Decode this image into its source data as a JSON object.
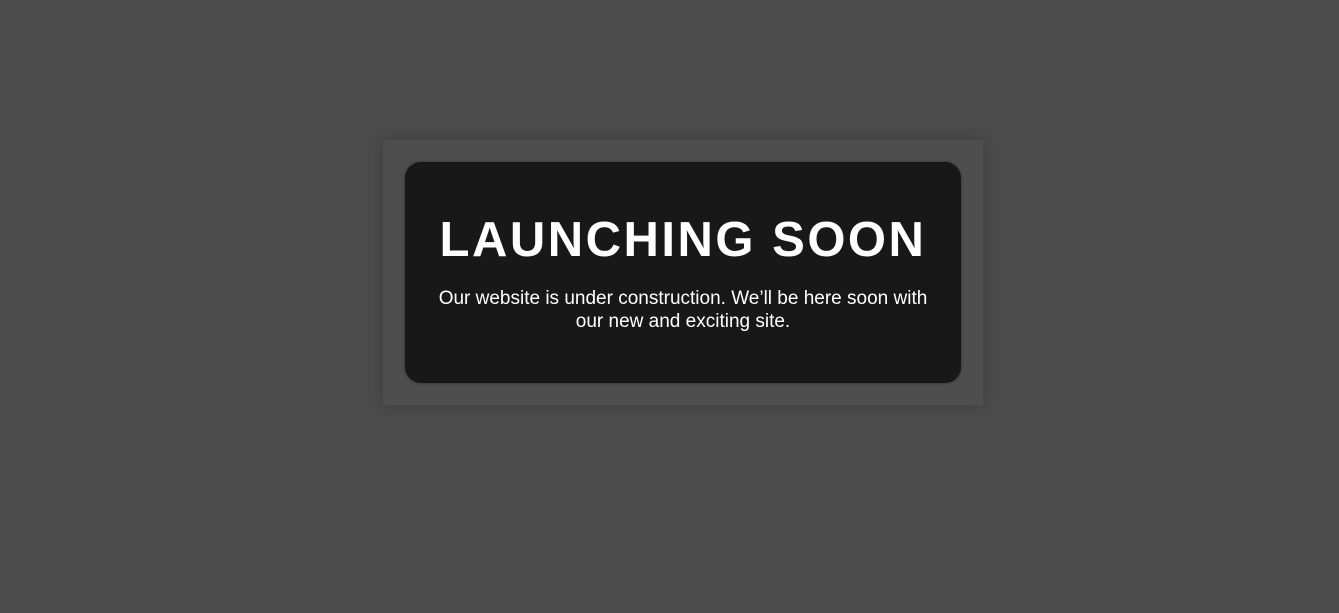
{
  "hero": {
    "title": "LAUNCHING SOON",
    "message": "Our website is under construction. We’ll be here soon with our new and exciting site."
  },
  "colors": {
    "background": "#4b4b4b",
    "frame": "#4e4e4e",
    "card": "#181818",
    "text": "#ffffff"
  }
}
